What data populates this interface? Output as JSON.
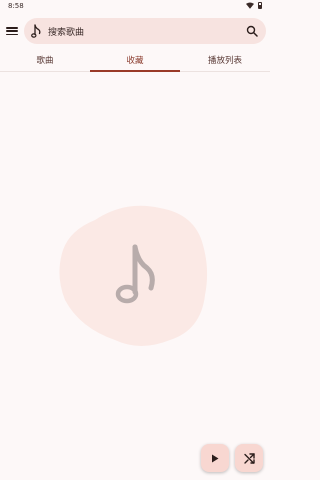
{
  "status_bar": {
    "time": "8:58"
  },
  "search": {
    "placeholder": "搜索歌曲"
  },
  "tabs": [
    {
      "label": "歌曲",
      "selected": false
    },
    {
      "label": "收藏",
      "selected": true
    },
    {
      "label": "播放列表",
      "selected": false
    }
  ],
  "empty_state": {
    "icon": "music-note-icon"
  },
  "actions": {
    "play_icon": "play-icon",
    "shuffle_icon": "shuffle-icon"
  },
  "colors": {
    "background": "#fdf8f8",
    "search_bar": "#f7e3e0",
    "accent": "#9a3a28",
    "blob": "#fbe9e5",
    "fab": "#f8d7d1"
  }
}
